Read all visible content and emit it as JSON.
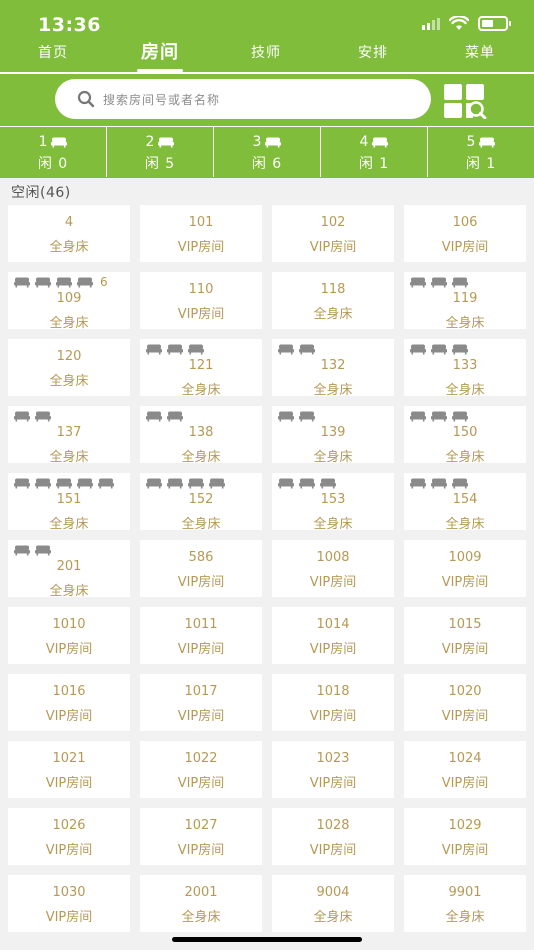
{
  "status_bar": {
    "time": "13:36"
  },
  "tabs": [
    "首页",
    "房间",
    "技师",
    "安排",
    "菜单"
  ],
  "search": {
    "placeholder": "搜索房间号或者名称"
  },
  "filters": [
    {
      "num": "1",
      "idle": "闲 0"
    },
    {
      "num": "2",
      "idle": "闲 5"
    },
    {
      "num": "3",
      "idle": "闲 6"
    },
    {
      "num": "4",
      "idle": "闲 1"
    },
    {
      "num": "5",
      "idle": "闲 1"
    }
  ],
  "section_title": "空闲(46)",
  "rooms": [
    {
      "room": "4",
      "type": "全身床",
      "beds": 0,
      "count": ""
    },
    {
      "room": "101",
      "type": "VIP房间",
      "beds": 0,
      "count": ""
    },
    {
      "room": "102",
      "type": "VIP房间",
      "beds": 0,
      "count": ""
    },
    {
      "room": "106",
      "type": "VIP房间",
      "beds": 0,
      "count": ""
    },
    {
      "room": "109",
      "type": "全身床",
      "beds": 4,
      "count": "6"
    },
    {
      "room": "110",
      "type": "VIP房间",
      "beds": 0,
      "count": ""
    },
    {
      "room": "118",
      "type": "全身床",
      "beds": 0,
      "count": ""
    },
    {
      "room": "119",
      "type": "全身床",
      "beds": 3,
      "count": ""
    },
    {
      "room": "120",
      "type": "全身床",
      "beds": 0,
      "count": ""
    },
    {
      "room": "121",
      "type": "全身床",
      "beds": 3,
      "count": ""
    },
    {
      "room": "132",
      "type": "全身床",
      "beds": 2,
      "count": ""
    },
    {
      "room": "133",
      "type": "全身床",
      "beds": 3,
      "count": ""
    },
    {
      "room": "137",
      "type": "全身床",
      "beds": 2,
      "count": ""
    },
    {
      "room": "138",
      "type": "全身床",
      "beds": 2,
      "count": ""
    },
    {
      "room": "139",
      "type": "全身床",
      "beds": 2,
      "count": ""
    },
    {
      "room": "150",
      "type": "全身床",
      "beds": 3,
      "count": ""
    },
    {
      "room": "151",
      "type": "全身床",
      "beds": 5,
      "count": ""
    },
    {
      "room": "152",
      "type": "全身床",
      "beds": 4,
      "count": ""
    },
    {
      "room": "153",
      "type": "全身床",
      "beds": 3,
      "count": ""
    },
    {
      "room": "154",
      "type": "全身床",
      "beds": 3,
      "count": ""
    },
    {
      "room": "201",
      "type": "全身床",
      "beds": 2,
      "count": ""
    },
    {
      "room": "586",
      "type": "VIP房间",
      "beds": 0,
      "count": ""
    },
    {
      "room": "1008",
      "type": "VIP房间",
      "beds": 0,
      "count": ""
    },
    {
      "room": "1009",
      "type": "VIP房间",
      "beds": 0,
      "count": ""
    },
    {
      "room": "1010",
      "type": "VIP房间",
      "beds": 0,
      "count": ""
    },
    {
      "room": "1011",
      "type": "VIP房间",
      "beds": 0,
      "count": ""
    },
    {
      "room": "1014",
      "type": "VIP房间",
      "beds": 0,
      "count": ""
    },
    {
      "room": "1015",
      "type": "VIP房间",
      "beds": 0,
      "count": ""
    },
    {
      "room": "1016",
      "type": "VIP房间",
      "beds": 0,
      "count": ""
    },
    {
      "room": "1017",
      "type": "VIP房间",
      "beds": 0,
      "count": ""
    },
    {
      "room": "1018",
      "type": "VIP房间",
      "beds": 0,
      "count": ""
    },
    {
      "room": "1020",
      "type": "VIP房间",
      "beds": 0,
      "count": ""
    },
    {
      "room": "1021",
      "type": "VIP房间",
      "beds": 0,
      "count": ""
    },
    {
      "room": "1022",
      "type": "VIP房间",
      "beds": 0,
      "count": ""
    },
    {
      "room": "1023",
      "type": "VIP房间",
      "beds": 0,
      "count": ""
    },
    {
      "room": "1024",
      "type": "VIP房间",
      "beds": 0,
      "count": ""
    },
    {
      "room": "1026",
      "type": "VIP房间",
      "beds": 0,
      "count": ""
    },
    {
      "room": "1027",
      "type": "VIP房间",
      "beds": 0,
      "count": ""
    },
    {
      "room": "1028",
      "type": "VIP房间",
      "beds": 0,
      "count": ""
    },
    {
      "room": "1029",
      "type": "VIP房间",
      "beds": 0,
      "count": ""
    },
    {
      "room": "1030",
      "type": "VIP房间",
      "beds": 0,
      "count": ""
    },
    {
      "room": "2001",
      "type": "全身床",
      "beds": 0,
      "count": ""
    },
    {
      "room": "9004",
      "type": "全身床",
      "beds": 0,
      "count": ""
    },
    {
      "room": "9901",
      "type": "全身床",
      "beds": 0,
      "count": ""
    }
  ],
  "colors": {
    "accent": "#80bd3a",
    "room_text": "#b49a55",
    "bed_icon": "#8a8a8a"
  },
  "icons": {
    "bed": "bed-icon",
    "search": "search-icon",
    "grid": "grid-search-icon"
  }
}
